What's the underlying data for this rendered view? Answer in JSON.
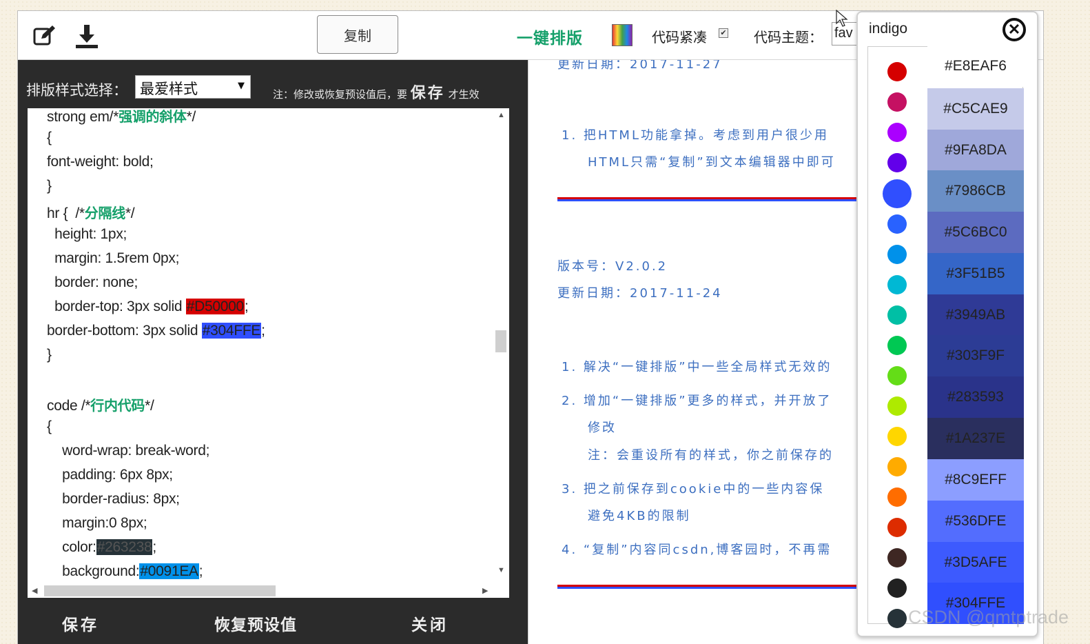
{
  "toolbar": {
    "edit_icon": "edit-icon",
    "download_icon": "download-icon",
    "copy_label": "复制",
    "oneclick_label": "一键排版",
    "compact_label": "代码紧凑",
    "compact_checked": true,
    "theme_label": "代码主题：",
    "theme_value": "fav"
  },
  "left_panel": {
    "style_label": "排版样式选择：",
    "style_value": "最爱样式",
    "note_prefix": "注：修改或恢复预设值后，要",
    "note_bold": "保存",
    "note_suffix": "才生效",
    "code_lines": {
      "l1": "strong em/*",
      "l1c": "强调的斜体",
      "l1e": "*/",
      "l2": "{",
      "l3": "font-weight: bold;",
      "l4": "}",
      "l5": "hr {  /*",
      "l5c": "分隔线",
      "l5e": "*/",
      "l6": "  height: 1px;",
      "l7": "  margin: 1.5rem 0px;",
      "l8": "  border: none;",
      "l9": "  border-top: 3px solid ",
      "l9c": "#D50000",
      "l9e": ";",
      "l10": "border-bottom: 3px solid ",
      "l10c": "#304FFE",
      "l10e": ";",
      "l11": "}",
      "l12": "",
      "l13": "code /*",
      "l13c": "行内代码",
      "l13e": "*/",
      "l14": "{",
      "l15": "    word-wrap: break-word;",
      "l16": "    padding: 6px 8px;",
      "l17": "    border-radius: 8px;",
      "l18": "    margin:0 8px;",
      "l19": "    color:",
      "l19c": "#263238",
      "l19e": ";",
      "l20": "    background:",
      "l20c": "#0091EA",
      "l20e": ";"
    },
    "save_label": "保存",
    "restore_label": "恢复预设值",
    "close_label": "关闭"
  },
  "preview": {
    "date_top": "更新日期：2017-11-27",
    "item1_a": "1.  把HTML功能拿掉。考虑到用户很少用",
    "item1_b": "HTML只需“复制”到文本编辑器中即可",
    "version": "版本号：V2.0.2",
    "date": "更新日期：2017-11-24",
    "item2": "1.  解决“一键排版”中一些全局样式无效的",
    "item3_a": "2.  增加“一键排版”更多的样式，并开放了",
    "item3_b": "修改",
    "item3_c": "注：会重设所有的样式，你之前保存的",
    "item4_a": "3.  把之前保存到cookie中的一些内容保",
    "item4_b": "避免4KB的限制",
    "item5": "4.  “复制”内容同csdn,博客园时，不再需"
  },
  "picker": {
    "title": "indigo",
    "close_icon": "close-circle-icon",
    "dots": [
      "#D50000",
      "#C51162",
      "#AA00FF",
      "#6200EA",
      "#304FFE",
      "#2962FF",
      "#0091EA",
      "#00B8D4",
      "#00BFA5",
      "#00C853",
      "#64DD17",
      "#AEEA00",
      "#FFD600",
      "#FFAB00",
      "#FF6D00",
      "#DD2C00",
      "#3E2723",
      "#212121",
      "#263238"
    ],
    "dot_tops": [
      88,
      132,
      176,
      220,
      265,
      309,
      353,
      397,
      441,
      485,
      529,
      573,
      617,
      661,
      705,
      749,
      793,
      837,
      881
    ],
    "selected_dot": 4,
    "shades": [
      {
        "hex": "#E8EAF6",
        "text": "#222222"
      },
      {
        "hex": "#C5CAE9",
        "text": "#222222"
      },
      {
        "hex": "#9FA8DA",
        "text": "#222222"
      },
      {
        "hex": "#7986CB",
        "text": "#222222"
      },
      {
        "hex": "#5C6BC0",
        "text": "#222222"
      },
      {
        "hex": "#3F51B5",
        "text": "#222222"
      },
      {
        "hex": "#3949AB",
        "text": "#222222"
      },
      {
        "hex": "#303F9F",
        "text": "#222222"
      },
      {
        "hex": "#283593",
        "text": "#222222"
      },
      {
        "hex": "#1A237E",
        "text": "#222222"
      },
      {
        "hex": "#8C9EFF",
        "text": "#222222"
      },
      {
        "hex": "#536DFE",
        "text": "#222222"
      },
      {
        "hex": "#3D5AFE",
        "text": "#222222"
      },
      {
        "hex": "#304FFE",
        "text": "#222222"
      }
    ],
    "shade_bgs": [
      "#ffffff",
      "#C5CAE9",
      "#9FA8DA",
      "#6a8fc6",
      "#5C6BC0",
      "#3566c8",
      "#2f3a96",
      "#2c3c95",
      "#2a338a",
      "#2a2f5e",
      "#8C9EFF",
      "#536DFE",
      "#3D5AFE",
      "#304FFE"
    ]
  },
  "watermark": "CSDN @qmtptrade"
}
